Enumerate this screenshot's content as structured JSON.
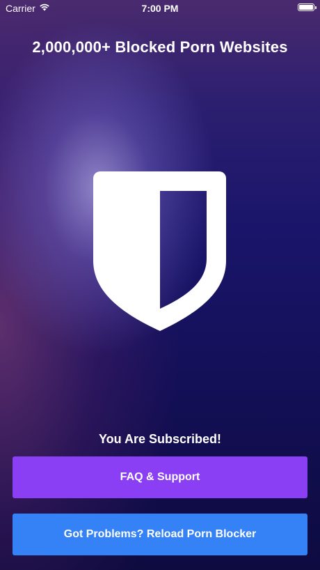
{
  "status_bar": {
    "carrier": "Carrier",
    "time": "7:00 PM",
    "battery_level": 1.0
  },
  "headline": "2,000,000+ Blocked Porn Websites",
  "icon": "shield-icon",
  "subscription_status": "You Are Subscribed!",
  "buttons": {
    "faq_label": "FAQ & Support",
    "reload_label": "Got Problems? Reload Porn Blocker"
  },
  "colors": {
    "faq_button": "#8a3ff5",
    "reload_button": "#3482f6",
    "text": "#ffffff"
  }
}
